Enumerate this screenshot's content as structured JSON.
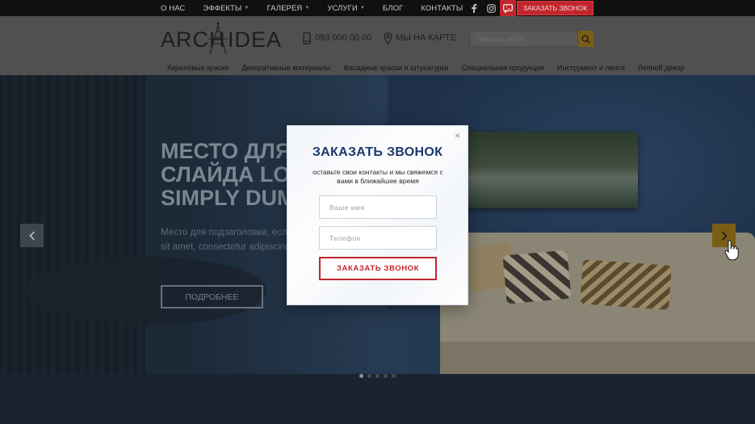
{
  "topnav": {
    "items": [
      {
        "label": "О НАС",
        "dropdown": false
      },
      {
        "label": "ЭФФЕКТЫ",
        "dropdown": true
      },
      {
        "label": "ГАЛЕРЕЯ",
        "dropdown": true
      },
      {
        "label": "УСЛУГИ",
        "dropdown": true
      },
      {
        "label": "БЛОГ",
        "dropdown": false
      },
      {
        "label": "КОНТАКТЫ",
        "dropdown": false
      }
    ],
    "order_call_label": "ЗАКАЗАТЬ ЗВОНОК"
  },
  "header": {
    "logo_left": "ARCH",
    "logo_right": "IDEA",
    "phone": "093 000 00 00",
    "map_label": "МЫ НА КАРТЕ",
    "search_placeholder": "Поиск на сайте..."
  },
  "catnav": {
    "items": [
      "Акриловые краски",
      "Декоративные материалы",
      "Фасадные краски и штукатурки",
      "Специальная продукция",
      "Инструмент и лента",
      "Лепной декор"
    ]
  },
  "slide": {
    "title_lines": [
      "МЕСТО ДЛЯ ЗАГОЛОВКА",
      "СЛАЙДА LOREM IPSUM",
      "SIMPLY DUMMY TEXT"
    ],
    "subtitle_lines": [
      "Место для подзаголовка, если он нужен. Lorem ipsum dolor",
      "sit amet, consectetur adipiscing elit"
    ],
    "button_label": "ПОДРОБНЕЕ",
    "dots_count": 5,
    "active_dot": 0
  },
  "modal": {
    "title": "ЗАКАЗАТЬ ЗВОНОК",
    "description": "оставьте свои контакты и мы свяжемся с вами в ближайшее время",
    "name_placeholder": "Ваше имя",
    "phone_placeholder": "Телефон",
    "submit_label": "ЗАКАЗАТЬ ЗВОНОК",
    "close_label": "×"
  },
  "colors": {
    "accent_red": "#c0272d",
    "accent_gold": "#c8981c",
    "modal_title": "#1d3a6b"
  }
}
